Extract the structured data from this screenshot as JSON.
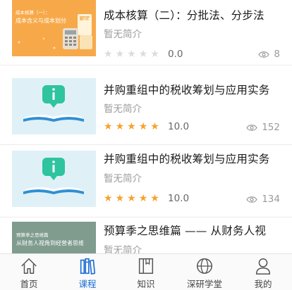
{
  "courses": [
    {
      "title": "成本核算（二）：分批法、分步法",
      "description": "暂无简介",
      "rating": 0,
      "score": "0.0",
      "views": "8",
      "thumb": {
        "style": "orange",
        "line1": "成本核算（一）：",
        "line2": "成本含义与成本划分",
        "tag": "成本"
      }
    },
    {
      "title": "并购重组中的税收筹划与应用实务",
      "description": "暂无简介",
      "rating": 5,
      "score": "10.0",
      "views": "152",
      "thumb": {
        "style": "blue"
      }
    },
    {
      "title": "并购重组中的税收筹划与应用实务",
      "description": "暂无简介",
      "rating": 5,
      "score": "10.0",
      "views": "134",
      "thumb": {
        "style": "blue"
      }
    },
    {
      "title": "预算季之思维篇 —— 从财务人视",
      "description": "暂无简介",
      "thumb": {
        "style": "green",
        "line1": "预算季之思维篇",
        "line2": "从财务人视角到经营者思维"
      }
    }
  ],
  "tabbar": {
    "active_color": "#1f6fd6",
    "items": [
      {
        "label": "首页",
        "icon": "home-icon",
        "active": false
      },
      {
        "label": "课程",
        "icon": "books-icon",
        "active": true
      },
      {
        "label": "知识",
        "icon": "book-icon",
        "active": false
      },
      {
        "label": "深研学堂",
        "icon": "globe-icon",
        "active": false
      },
      {
        "label": "我的",
        "icon": "person-icon",
        "active": false
      }
    ]
  },
  "colors": {
    "star_on": "#f5a32c",
    "star_off": "#dcdcdc",
    "orange_thumb": "#f7a94a",
    "blue_thumb": "#dff1f7",
    "green_thumb": "#7f9c8f"
  }
}
